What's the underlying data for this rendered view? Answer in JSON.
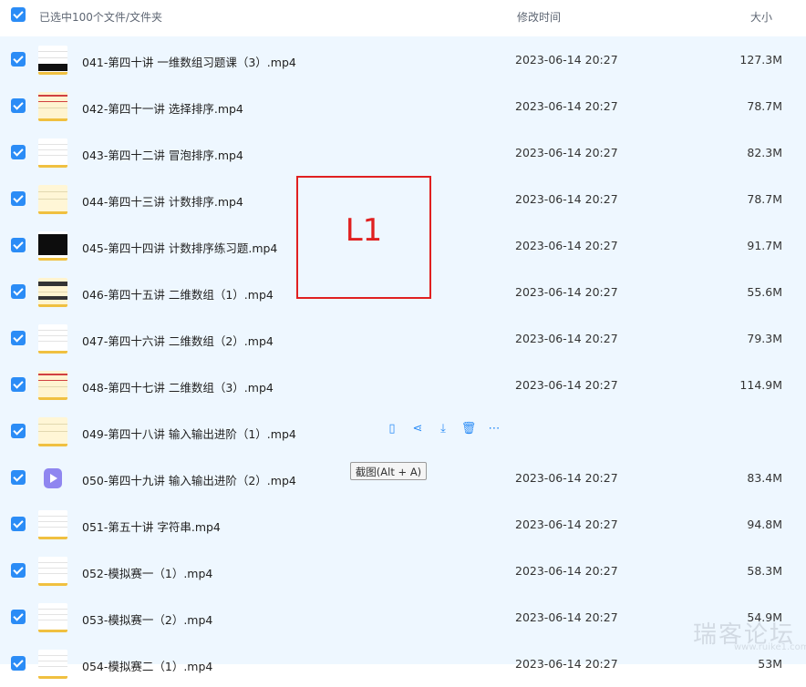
{
  "header": {
    "selection_label": "已选中100个文件/文件夹",
    "mtime_label": "修改时间",
    "size_label": "大小"
  },
  "rows": [
    {
      "name": "041-第四十讲 一维数组习题课（3）.mp4",
      "mtime": "2023-06-14 20:27",
      "size": "127.3M",
      "thumb": "slide-dark-corner"
    },
    {
      "name": "042-第四十一讲 选择排序.mp4",
      "mtime": "2023-06-14 20:27",
      "size": "78.7M",
      "thumb": "slide-yellow-red"
    },
    {
      "name": "043-第四十二讲 冒泡排序.mp4",
      "mtime": "2023-06-14 20:27",
      "size": "82.3M",
      "thumb": "slide-white"
    },
    {
      "name": "044-第四十三讲 计数排序.mp4",
      "mtime": "2023-06-14 20:27",
      "size": "78.7M",
      "thumb": "slide-yellow"
    },
    {
      "name": "045-第四十四讲 计数排序练习题.mp4",
      "mtime": "2023-06-14 20:27",
      "size": "91.7M",
      "thumb": "slide-black"
    },
    {
      "name": "046-第四十五讲 二维数组（1）.mp4",
      "mtime": "2023-06-14 20:27",
      "size": "55.6M",
      "thumb": "slide-yellow-dark"
    },
    {
      "name": "047-第四十六讲 二维数组（2）.mp4",
      "mtime": "2023-06-14 20:27",
      "size": "79.3M",
      "thumb": "slide-white"
    },
    {
      "name": "048-第四十七讲 二维数组（3）.mp4",
      "mtime": "2023-06-14 20:27",
      "size": "114.9M",
      "thumb": "slide-yellow-red"
    },
    {
      "name": "049-第四十八讲 输入输出进阶（1）.mp4",
      "mtime": "",
      "size": "",
      "thumb": "slide-yellow",
      "hover": true
    },
    {
      "name": "050-第四十九讲 输入输出进阶（2）.mp4",
      "mtime": "2023-06-14 20:27",
      "size": "83.4M",
      "thumb": "video-icon"
    },
    {
      "name": "051-第五十讲 字符串.mp4",
      "mtime": "2023-06-14 20:27",
      "size": "94.8M",
      "thumb": "slide-white"
    },
    {
      "name": "052-模拟赛一（1）.mp4",
      "mtime": "2023-06-14 20:27",
      "size": "58.3M",
      "thumb": "slide-white"
    },
    {
      "name": "053-模拟赛一（2）.mp4",
      "mtime": "2023-06-14 20:27",
      "size": "54.9M",
      "thumb": "slide-white"
    },
    {
      "name": "054-模拟赛二（1）.mp4",
      "mtime": "2023-06-14 20:27",
      "size": "53M",
      "thumb": "slide-white"
    }
  ],
  "hover_actions": [
    {
      "icon": "mobile-icon",
      "label": "在手机上打开"
    },
    {
      "icon": "share-icon",
      "label": "分享"
    },
    {
      "icon": "download-icon",
      "label": "下载"
    },
    {
      "icon": "trash-icon",
      "label": "删除"
    },
    {
      "icon": "more-icon",
      "label": "更多"
    }
  ],
  "tooltip": "截图(Alt + A)",
  "annotation_label": "L1",
  "watermark": "瑞客论坛",
  "watermark_sub": "www.ruike1.com",
  "colors": {
    "accent": "#2b8cf6",
    "row_selected_bg": "#eef7ff",
    "annotation": "#e02020"
  }
}
